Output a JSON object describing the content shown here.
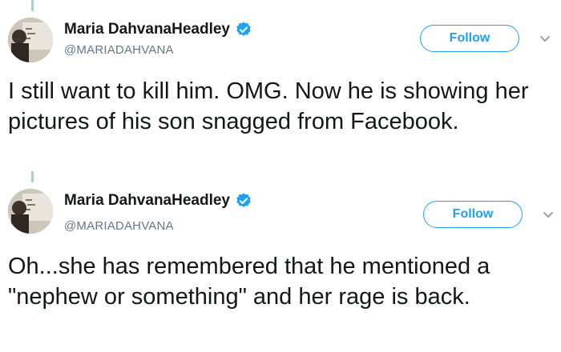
{
  "tweets": [
    {
      "display_name": "Maria DahvanaHeadley",
      "handle": "@MARIADAHVANA",
      "follow_label": "Follow",
      "text": "I still want to kill him. OMG. Now he is showing her pictures of his son snagged from Facebook."
    },
    {
      "display_name": "Maria DahvanaHeadley",
      "handle": "@MARIADAHVANA",
      "follow_label": "Follow",
      "text": "Oh...she has remembered that he mentioned a \"nephew or something\" and her rage is back."
    }
  ],
  "colors": {
    "brand_blue": "#1da1f2",
    "thread_line": "#9ad8c8",
    "handle_gray": "#657786"
  },
  "icons": [
    "verified-badge-icon",
    "chevron-down-icon",
    "avatar"
  ]
}
